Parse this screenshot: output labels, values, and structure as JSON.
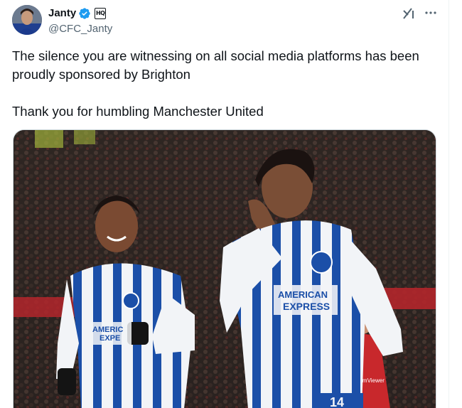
{
  "author": {
    "display_name": "Janty",
    "handle": "@CFC_Janty",
    "verified": true,
    "affiliate_badge": "HQ",
    "avatar_icon": "avatar-photo"
  },
  "actions": {
    "grok_icon": "grok-icon",
    "more_icon": "more-options-icon"
  },
  "tweet": {
    "line1": "The silence you are witnessing on all social media platforms has been",
    "line2": "proudly sponsored by Brighton",
    "line3": "Thank you for humbling Manchester United"
  },
  "media": {
    "description_icon": "photo",
    "shirt_sponsor_left": "AMERIC EXPE",
    "shirt_sponsor_right_1": "AMERICAN",
    "shirt_sponsor_right_2": "EXPRESS",
    "shirt_number": "14",
    "background_shirt_text": "TeamViewer",
    "colors": {
      "stripe_blue": "#1b4fa8",
      "stripe_white": "#f2f4f7",
      "crowd_dark": "#2a2220",
      "red": "#b3262b"
    }
  }
}
